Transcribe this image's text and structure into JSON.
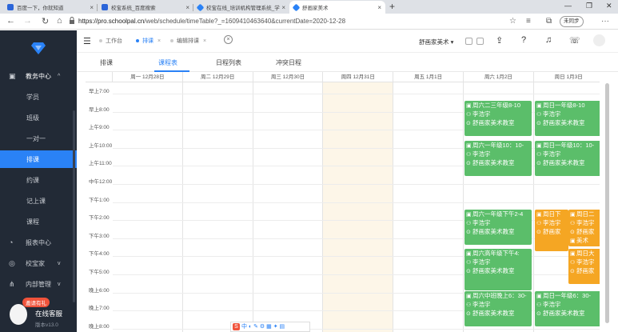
{
  "browser": {
    "tabs": [
      {
        "title": "百度一下，你就知道",
        "color": "#2b65d9"
      },
      {
        "title": "校宝系统_百度搜索",
        "color": "#2b65d9"
      },
      {
        "title": "校宝在线_培训机构管理系统_学习",
        "color": "#2a82f6"
      },
      {
        "title": "舒画家美术",
        "color": "#2a82f6"
      }
    ],
    "new_tab": "+",
    "url_host": "https://pro.schoolpal.cn",
    "url_path": "/web/schedule/timeTable?_=1609410463640&currentDate=2020-12-28",
    "sync_label": "未同步"
  },
  "sidebar": {
    "menu": [
      {
        "label": "教务中心",
        "type": "group",
        "icon": "calendar-icon",
        "expanded": true
      },
      {
        "label": "学员",
        "type": "sub"
      },
      {
        "label": "班级",
        "type": "sub"
      },
      {
        "label": "一对一",
        "type": "sub"
      },
      {
        "label": "排课",
        "type": "sub",
        "selected": true
      },
      {
        "label": "约课",
        "type": "sub"
      },
      {
        "label": "记上课",
        "type": "sub"
      },
      {
        "label": "课程",
        "type": "sub"
      },
      {
        "label": "报表中心",
        "type": "group",
        "icon": "report-icon"
      },
      {
        "label": "校宝家",
        "type": "group",
        "icon": "home-icon"
      },
      {
        "label": "内部管理",
        "type": "group",
        "icon": "org-icon"
      }
    ],
    "support_badge": "邀请有礼",
    "support_title": "在线客服",
    "version": "版本v13.0"
  },
  "header": {
    "tabs": [
      {
        "label": "工作台",
        "active": false,
        "closable": false
      },
      {
        "label": "排课",
        "active": true,
        "closable": true
      },
      {
        "label": "编辑排课",
        "active": false,
        "closable": true
      }
    ],
    "school": "舒画家美术"
  },
  "subtabs": [
    "排课",
    "课程表",
    "日程列表",
    "冲突日程"
  ],
  "active_subtab": 1,
  "schedule": {
    "days": [
      "周一 12月28日",
      "周二 12月29日",
      "周三 12月30日",
      "周四 12月31日",
      "周五 1月1日",
      "周六 1月2日",
      "周日 1月3日"
    ],
    "today_index": 3,
    "times": [
      "早上7:00",
      "早上8:00",
      "上午9:00",
      "上午10:00",
      "上午11:00",
      "中午12:00",
      "下午1:00",
      "下午2:00",
      "下午3:00",
      "下午4:00",
      "下午5:00",
      "晚上6:00",
      "晚上7:00",
      "晚上8:00"
    ],
    "events": [
      {
        "day": 5,
        "lines": [
          "周六二三年级8-10",
          "李浩宇",
          "舒画家美术教室"
        ],
        "color": "green"
      },
      {
        "day": 6,
        "lines": [
          "周日一年级8-10",
          "李浩宇",
          "舒画家美术教室"
        ],
        "color": "green"
      },
      {
        "day": 5,
        "lines": [
          "周六一年级10：10-",
          "李浩宇",
          "舒画家美术教室"
        ],
        "color": "green"
      },
      {
        "day": 6,
        "lines": [
          "周日一年级10：10-",
          "李浩宇",
          "舒画家美术教室"
        ],
        "color": "green"
      },
      {
        "day": 5,
        "lines": [
          "周六一年级下午2-4",
          "李浩宇",
          "舒画家美术教室"
        ],
        "color": "green"
      },
      {
        "day": 6,
        "lines": [
          "周日下",
          "李浩宇",
          "舒画家"
        ],
        "color": "orange"
      },
      {
        "day": 6,
        "lines": [
          "周日二",
          "李浩宇",
          "舒画家",
          "美术"
        ],
        "color": "orange"
      },
      {
        "day": 5,
        "lines": [
          "周六高年级下午4:",
          "李浩宇",
          "舒画家美术教室"
        ],
        "color": "green"
      },
      {
        "day": 6,
        "lines": [
          "周日大",
          "李浩宇",
          "舒画家"
        ],
        "color": "orange"
      },
      {
        "day": 5,
        "lines": [
          "周六中班晚上6：30-",
          "李浩宇",
          "舒画家美术教室"
        ],
        "color": "green"
      },
      {
        "day": 6,
        "lines": [
          "周日一年级6：30-",
          "李浩宇",
          "舒画家美术教室"
        ],
        "color": "green"
      }
    ]
  },
  "ime": "中"
}
